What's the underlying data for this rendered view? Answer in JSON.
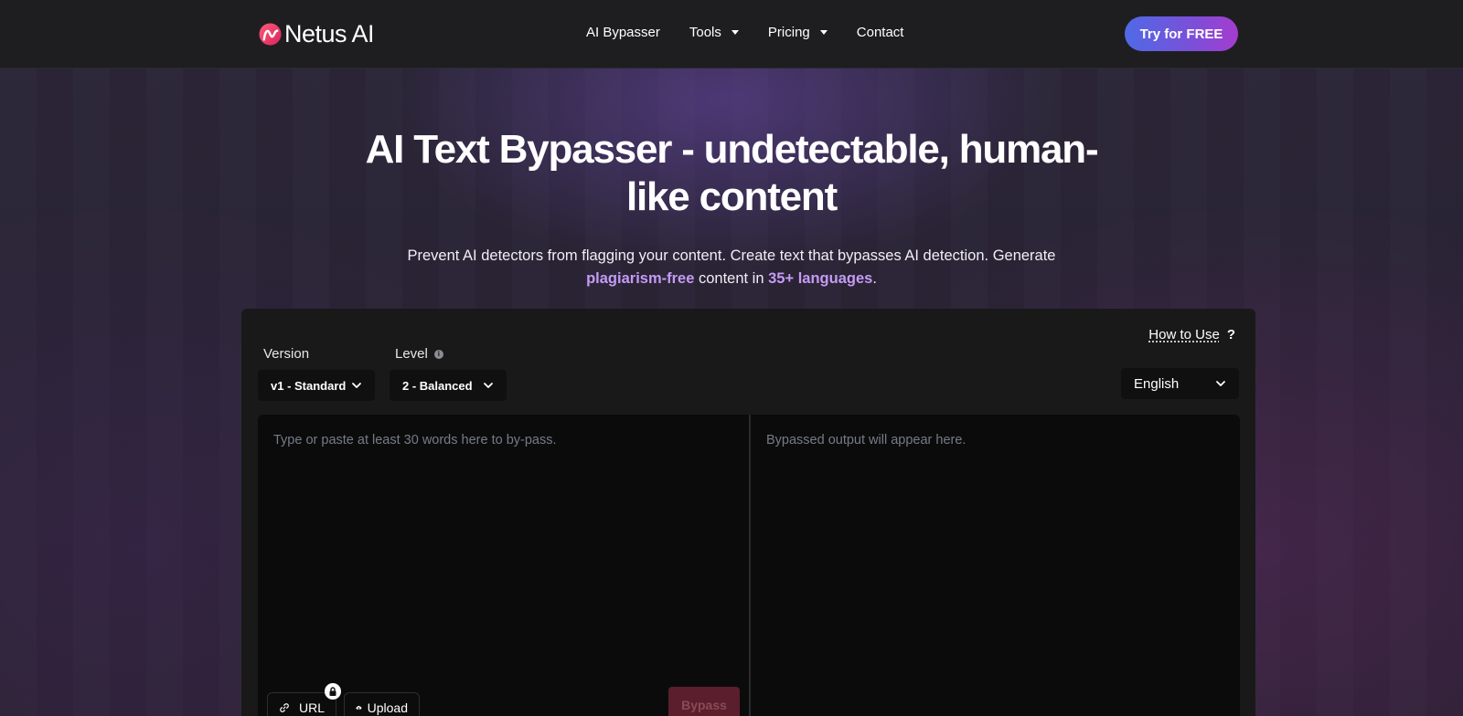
{
  "nav": {
    "logo_text": "Netus AI",
    "links": [
      {
        "label": "AI Bypasser",
        "has_dropdown": false
      },
      {
        "label": "Tools",
        "has_dropdown": true
      },
      {
        "label": "Pricing",
        "has_dropdown": true
      },
      {
        "label": "Contact",
        "has_dropdown": false
      }
    ],
    "cta_label": "Try for FREE"
  },
  "hero": {
    "title_line1": "AI Text Bypasser - undetectable, human-",
    "title_line2": "like content",
    "subtitle_part1": "Prevent AI detectors from flagging your content. Create text that bypasses AI detection. Generate",
    "subtitle_highlight1": "plagiarism-free",
    "subtitle_part2": " content in ",
    "subtitle_highlight2": "35+ languages",
    "subtitle_part3": "."
  },
  "tool": {
    "how_to_label": "How to Use",
    "how_to_icon": "?",
    "version_label": "Version",
    "version_value": "v1 - Standard",
    "level_label": "Level",
    "level_value": "2 - Balanced",
    "language_value": "English",
    "input_placeholder": "Type or paste at least 30 words here to by-pass.",
    "output_placeholder": "Bypassed output will appear here.",
    "url_label": "URL",
    "upload_label": "Upload",
    "bypass_label": "Bypass"
  },
  "colors": {
    "accent_start": "#4f6ae6",
    "accent_end": "#a53ccf",
    "highlight": "#c59bf5",
    "bypass_disabled": "#5a1e2c"
  }
}
